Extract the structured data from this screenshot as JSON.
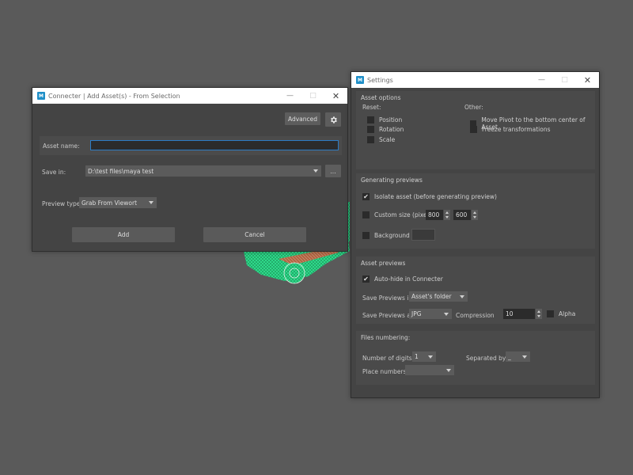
{
  "colors": {
    "background": "#5a5a5a",
    "window_bg": "#444444",
    "accent": "#2d7cc4",
    "model_green": "#3ef09a"
  },
  "connecter": {
    "title": "Connecter | Add Asset(s) - From Selection",
    "advanced_label": "Advanced",
    "asset_name_label": "Asset name:",
    "asset_name_value": "",
    "save_in_label": "Save in:",
    "save_in_value": "D:\\test files\\maya test",
    "browse_label": "...",
    "preview_type_label": "Preview type:",
    "preview_type_value": "Grab From Viewort",
    "add_label": "Add",
    "cancel_label": "Cancel"
  },
  "settings": {
    "title": "Settings",
    "asset_options": {
      "title": "Asset options",
      "reset_label": "Reset:",
      "position_label": "Position",
      "rotation_label": "Rotation",
      "scale_label": "Scale",
      "other_label": "Other:",
      "move_pivot_label": "Move Pivot to the bottom center of Asset",
      "freeze_label": "Freeze transformations"
    },
    "generating_previews": {
      "title": "Generating previews",
      "isolate_label": "Isolate asset (before generating preview)",
      "isolate_checked": true,
      "custom_size_label": "Custom size (pixel)",
      "width_value": "800",
      "height_value": "600",
      "background_label": "Background"
    },
    "asset_previews": {
      "title": "Asset previews",
      "autohide_label": "Auto-hide in Connecter",
      "autohide_checked": true,
      "save_in_label": "Save Previews in:",
      "save_in_value": "Asset's folder",
      "save_as_label": "Save Previews as:",
      "save_as_value": "JPG",
      "compression_label": "Compression",
      "compression_value": "10",
      "alpha_label": "Alpha"
    },
    "files_numbering": {
      "title": "Files numbering:",
      "digits_label": "Number of digits:",
      "digits_value": "1",
      "separated_label": "Separated by:",
      "separated_value": "_",
      "place_label": "Place numbers:",
      "place_value": ""
    }
  }
}
